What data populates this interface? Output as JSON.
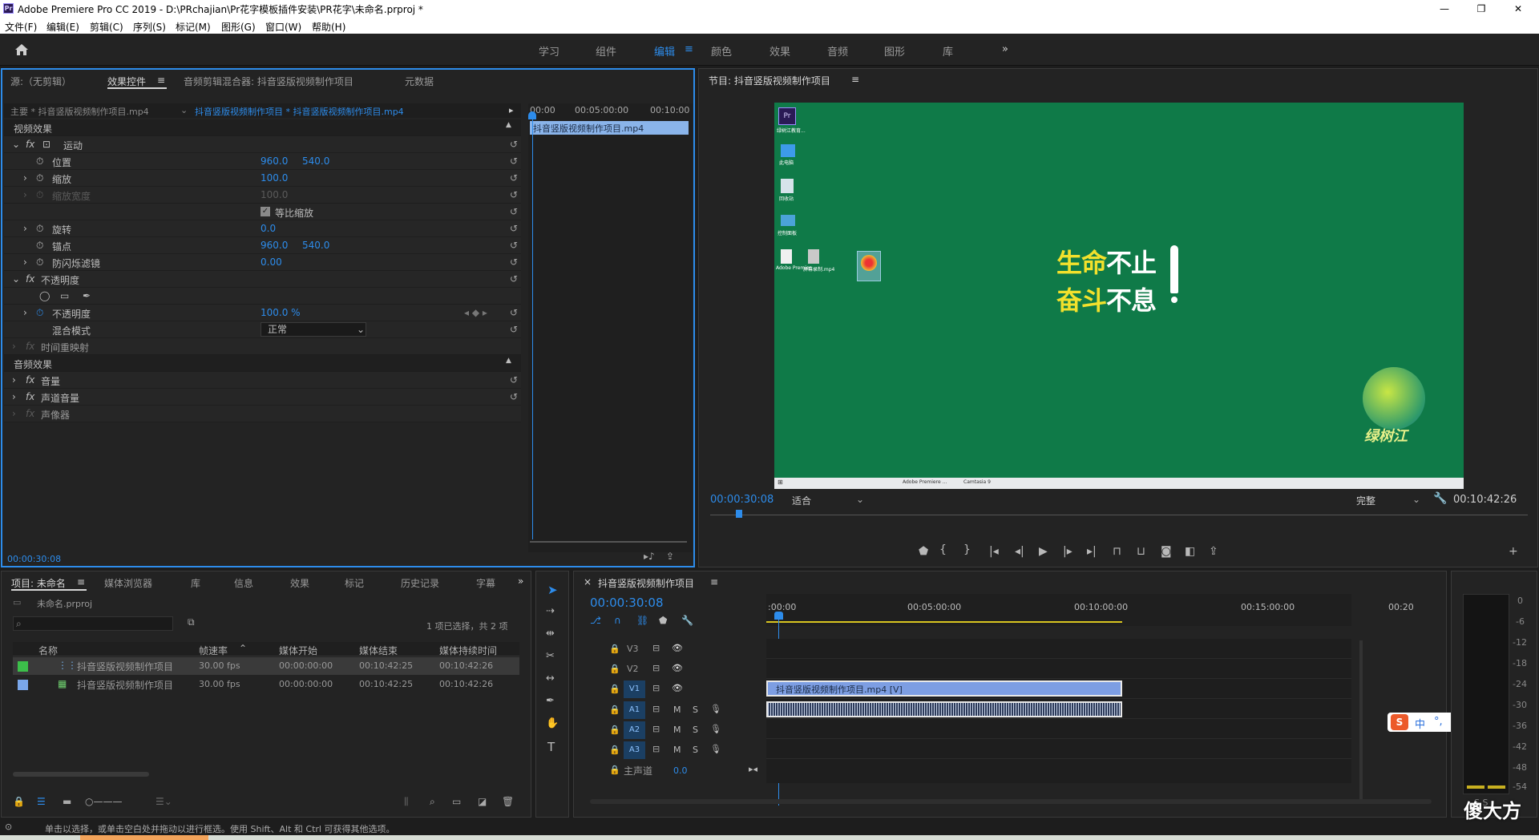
{
  "window": {
    "title": "Adobe Premiere Pro CC 2019 - D:\\PRchajian\\Pr花字模板插件安装\\PR花字\\未命名.prproj *",
    "app_icon": "Pr",
    "min": "—",
    "max": "❐",
    "close": "✕"
  },
  "menu": [
    "文件(F)",
    "编辑(E)",
    "剪辑(C)",
    "序列(S)",
    "标记(M)",
    "图形(G)",
    "窗口(W)",
    "帮助(H)"
  ],
  "workspaces": [
    "学习",
    "组件",
    "编辑",
    "颜色",
    "效果",
    "音频",
    "图形",
    "库"
  ],
  "workspace_active": "编辑",
  "source_panel": {
    "tabs": [
      "源:（无剪辑）",
      "效果控件",
      "音频剪辑混合器: 抖音竖版视频制作项目",
      "元数据"
    ],
    "master": "主要 * 抖音竖版视频制作项目.mp4",
    "sequence_clip": "抖音竖版视频制作项目 * 抖音竖版视频制作项目.mp4",
    "ruler": [
      "00:00",
      "00:05:00:00",
      "00:10:00"
    ],
    "clip_name": "抖音竖版视频制作项目.mp4",
    "video_header": "视频效果",
    "audio_header": "音频效果",
    "motion": "运动",
    "position": "位置",
    "position_x": "960.0",
    "position_y": "540.0",
    "scale": "缩放",
    "scale_val": "100.0",
    "scale_width": "缩放宽度",
    "scale_width_val": "100.0",
    "uniform": "等比缩放",
    "rotation": "旋转",
    "rotation_val": "0.0",
    "anchor": "锚点",
    "anchor_x": "960.0",
    "anchor_y": "540.0",
    "antiflicker": "防闪烁滤镜",
    "antiflicker_val": "0.00",
    "opacity": "不透明度",
    "opacity_prop": "不透明度",
    "opacity_val": "100.0 %",
    "blend": "混合模式",
    "blend_val": "正常",
    "timeremap": "时间重映射",
    "volume": "音量",
    "channel_volume": "声道音量",
    "panner": "声像器",
    "timecode": "00:00:30:08"
  },
  "program": {
    "title": "节目: 抖音竖版视频制作项目",
    "timecode": "00:00:30:08",
    "fit": "适合",
    "quality": "完整",
    "duration": "00:10:42:26",
    "headline1a": "生命",
    "headline1b": "不止",
    "headline2a": "奋斗",
    "headline2b": "不息",
    "logo_text": "绿树江",
    "desktop_icons": [
      "Adobe Premier...",
      "屏幕录制.mp4",
      "回收站",
      "此电脑",
      "控制面板",
      "绿树江教育..."
    ],
    "taskbar": [
      "Adobe Premiere ...",
      "Camtasia 9"
    ]
  },
  "project": {
    "tabs": [
      "项目: 未命名",
      "媒体浏览器",
      "库",
      "信息",
      "效果",
      "标记",
      "历史记录",
      "字幕"
    ],
    "file": "未命名.prproj",
    "selected": "1 项已选择，共 2 项",
    "columns": [
      "名称",
      "帧速率",
      "媒体开始",
      "媒体结束",
      "媒体持续时间"
    ],
    "items": [
      {
        "name": "抖音竖版视频制作项目",
        "fps": "30.00 fps",
        "start": "00:00:00:00",
        "end": "00:10:42:25",
        "dur": "00:10:42:26",
        "color": "#3cbf4a"
      },
      {
        "name": "抖音竖版视频制作项目",
        "fps": "30.00 fps",
        "start": "00:00:00:00",
        "end": "00:10:42:25",
        "dur": "00:10:42:26",
        "color": "#7aa7ea"
      }
    ]
  },
  "timeline": {
    "title": "抖音竖版视频制作项目",
    "timecode": "00:00:30:08",
    "ruler": [
      ":00:00",
      "00:05:00:00",
      "00:10:00:00",
      "00:15:00:00",
      "00:20"
    ],
    "tracks": [
      "V3",
      "V2",
      "V1",
      "A1",
      "A2",
      "A3"
    ],
    "master": "主声道",
    "master_val": "0.0",
    "clip_label": "抖音竖版视频制作项目.mp4 [V]"
  },
  "meter": [
    "0",
    "-6",
    "-12",
    "-18",
    "-24",
    "-30",
    "-36",
    "-42",
    "-48",
    "-54"
  ],
  "meter_bottom": "S S",
  "status": "单击以选择，或单击空白处并拖动以进行框选。使用 Shift、Alt 和 Ctrl 可获得其他选项。",
  "ime": [
    "中",
    "°,"
  ],
  "watermark": "傻大方",
  "accent": "#2d8ceb"
}
